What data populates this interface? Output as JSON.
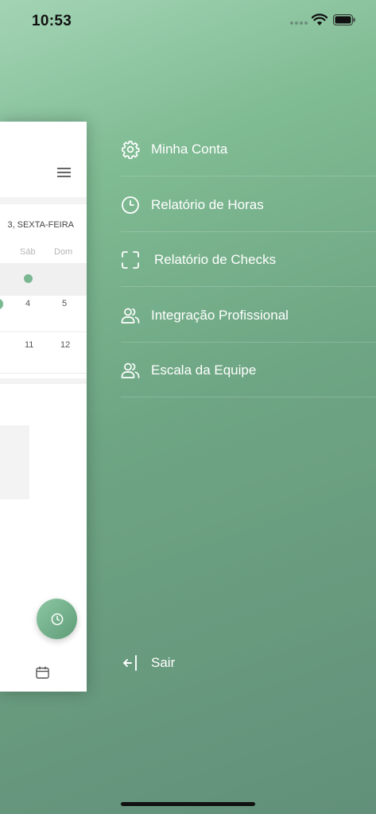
{
  "status_bar": {
    "time": "10:53"
  },
  "app_card": {
    "date_label": "3, SEXTA-FEIRA",
    "week_days": [
      "Sáb",
      "Dom"
    ],
    "row2": [
      "4",
      "5"
    ],
    "row3": [
      "11",
      "12"
    ]
  },
  "menu": {
    "items": [
      {
        "label": "Minha Conta",
        "icon": "gear-icon"
      },
      {
        "label": "Relatório de Horas",
        "icon": "clock-icon"
      },
      {
        "label": "Relatório de Checks",
        "icon": "scan-frame-icon"
      },
      {
        "label": "Integração Profissional",
        "icon": "users-icon"
      },
      {
        "label": "Escala da Equipe",
        "icon": "users-icon"
      }
    ],
    "logout_label": "Sair"
  },
  "colors": {
    "accent": "#7ab892",
    "menu_bg_top": "#a3d4b4",
    "menu_bg_bottom": "#62907a"
  }
}
